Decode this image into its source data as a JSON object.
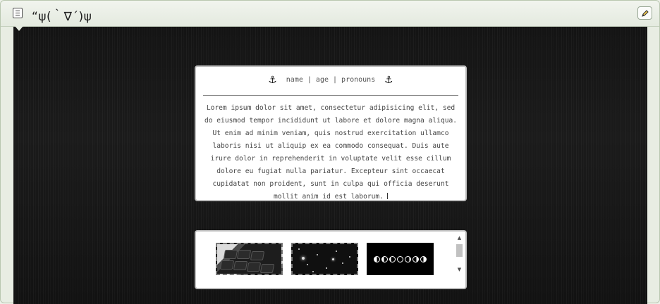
{
  "header": {
    "title": "“ψ(｀∇´)ψ"
  },
  "card": {
    "anchor_glyph": "⚓",
    "head_text": "name | age | pronouns",
    "body": "Lorem ipsum dolor sit amet, consectetur adipisicing elit, sed do eiusmod tempor incididunt ut labore et dolore magna aliqua. Ut enim ad minim veniam, quis nostrud exercitation ullamco laboris nisi ut aliquip ex ea commodo consequat. Duis aute irure dolor in reprehenderit in voluptate velit esse cillum dolore eu fugiat nulla pariatur. Excepteur sint occaecat cupidatat non proident, sunt in culpa qui officia deserunt mollit anim id est laborum."
  },
  "gallery": {
    "images": [
      "keyboard-photo",
      "starry-sky-photo",
      "moon-phases-image"
    ]
  },
  "colors": {
    "stage": "#161616",
    "card": "#ffffff",
    "card_border": "#bdbdbd",
    "header": "#e8ede3"
  },
  "icons": {
    "page": "page-icon",
    "edit": "pencil-icon",
    "anchor": "anchor-icon"
  }
}
